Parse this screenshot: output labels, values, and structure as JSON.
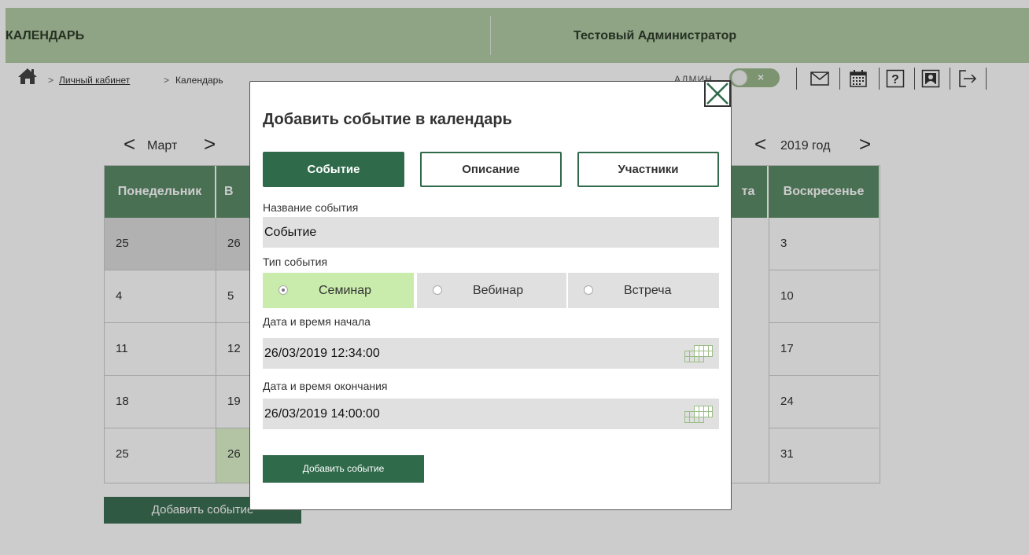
{
  "header": {
    "title": "КАЛЕНДАРЬ",
    "user": "Тестовый Администратор"
  },
  "breadcrumb": {
    "items": [
      "Личный кабинет",
      "Календарь"
    ],
    "separator": ">"
  },
  "toolbar": {
    "role_label": "АДМИН",
    "toggle_label": "×",
    "icons": [
      "mail-icon",
      "calendar-icon",
      "help-icon",
      "profile-icon",
      "logout-icon"
    ]
  },
  "calendar": {
    "month": "Март",
    "year": "2019 год",
    "prev": "<",
    "next": ">",
    "weekdays": [
      "Понедельник",
      "В",
      "",
      "",
      "",
      "та",
      "Воскресенье"
    ],
    "rows": [
      [
        "25",
        "26",
        "",
        "",
        "",
        "",
        "3"
      ],
      [
        "4",
        "5",
        "",
        "",
        "",
        "",
        "10"
      ],
      [
        "11",
        "12",
        "",
        "",
        "",
        "",
        "17"
      ],
      [
        "18",
        "19",
        "",
        "",
        "",
        "",
        "24"
      ],
      [
        "25",
        "26",
        "",
        "",
        "",
        "",
        "31"
      ]
    ],
    "add_button": "Добавить событие"
  },
  "modal": {
    "title": "Добавить событие в календарь",
    "tabs": [
      "Событие",
      "Описание",
      "Участники"
    ],
    "active_tab": "Событие",
    "event_name_label": "Название события",
    "event_name_value": "Событие",
    "event_type_label": "Тип события",
    "event_types": [
      "Семинар",
      "Вебинар",
      "Встреча"
    ],
    "selected_type": "Семинар",
    "start_label": "Дата и время начала",
    "start_value": "26/03/2019 12:34:00",
    "end_label": "Дата и время окончания",
    "end_value": "26/03/2019 14:00:00",
    "submit": "Добавить событие"
  },
  "colors": {
    "header": "#b3cea7",
    "primary": "#2f6a4a",
    "selected_option": "#c9ecac"
  }
}
